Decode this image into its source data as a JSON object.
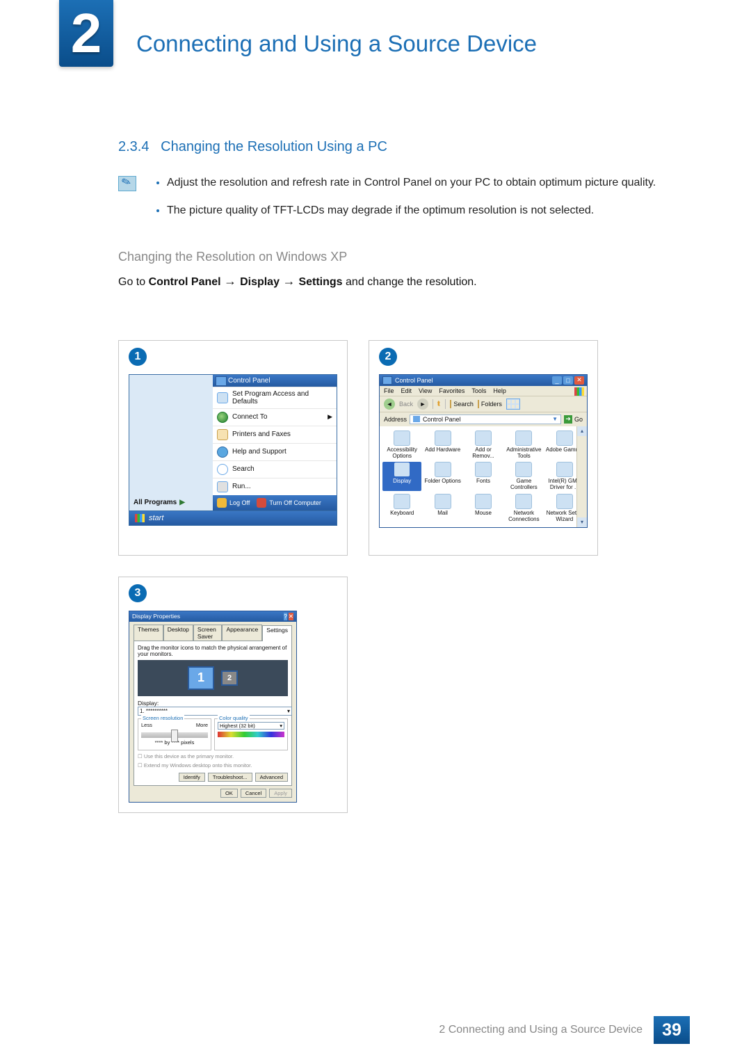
{
  "chapter": {
    "number": "2",
    "title": "Connecting and Using a Source Device"
  },
  "section": {
    "number": "2.3.4",
    "title": "Changing the Resolution Using a PC"
  },
  "notes": [
    "Adjust the resolution and refresh rate in Control Panel on your PC to obtain optimum picture quality.",
    "The picture quality of TFT-LCDs may degrade if the optimum resolution is not selected."
  ],
  "sub": {
    "title": "Changing the Resolution on Windows XP",
    "nav_prefix": "Go to ",
    "nav_parts": [
      "Control Panel",
      "Display",
      "Settings"
    ],
    "nav_suffix": " and change the resolution."
  },
  "panel1": {
    "badge": "1",
    "header": "Control Panel",
    "items": [
      "Set Program Access and Defaults",
      "Connect To",
      "Printers and Faxes",
      "Help and Support",
      "Search",
      "Run..."
    ],
    "all_programs": "All Programs",
    "logoff": "Log Off",
    "turnoff": "Turn Off Computer",
    "start": "start"
  },
  "panel2": {
    "badge": "2",
    "title": "Control Panel",
    "menu": [
      "File",
      "Edit",
      "View",
      "Favorites",
      "Tools",
      "Help"
    ],
    "back": "Back",
    "search": "Search",
    "folders": "Folders",
    "addr_label": "Address",
    "addr_value": "Control Panel",
    "go": "Go",
    "grid": [
      "Accessibility Options",
      "Add Hardware",
      "Add or Remov...",
      "Administrative Tools",
      "Adobe Gamma",
      "Display",
      "Folder Options",
      "Fonts",
      "Game Controllers",
      "Intel(R) GMA Driver for ...",
      "Keyboard",
      "Mail",
      "Mouse",
      "Network Connections",
      "Network Setup Wizard"
    ]
  },
  "panel3": {
    "badge": "3",
    "title": "Display Properties",
    "tabs": [
      "Themes",
      "Desktop",
      "Screen Saver",
      "Appearance",
      "Settings"
    ],
    "help": "Drag the monitor icons to match the physical arrangement of your monitors.",
    "mon1": "1",
    "mon2": "2",
    "display_label": "Display:",
    "display_value": "1. **********",
    "sr_label": "Screen resolution",
    "sr_less": "Less",
    "sr_more": "More",
    "sr_line": "**** by **** pixels",
    "cq_label": "Color quality",
    "cq_value": "Highest (32 bit)",
    "chk1": "Use this device as the primary monitor.",
    "chk2": "Extend my Windows desktop onto this monitor.",
    "actions": [
      "Identify",
      "Troubleshoot...",
      "Advanced"
    ],
    "okrow": [
      "OK",
      "Cancel",
      "Apply"
    ]
  },
  "footer": {
    "text": "2 Connecting and Using a Source Device",
    "page": "39"
  }
}
